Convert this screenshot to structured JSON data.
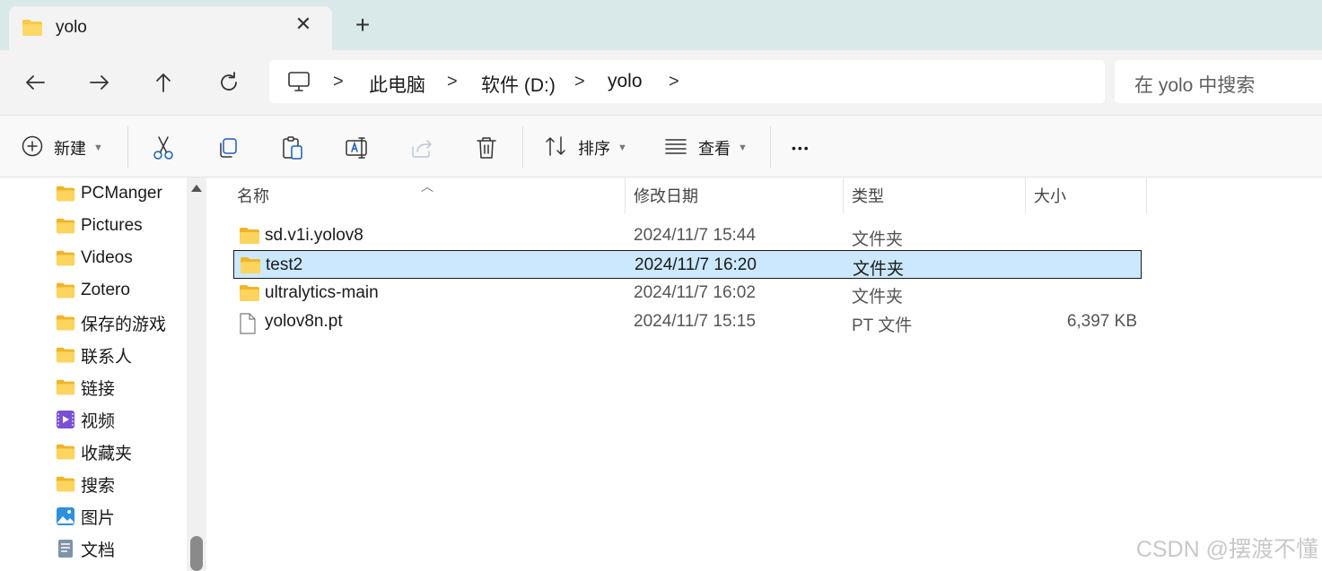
{
  "tab": {
    "title": "yolo",
    "close_glyph": "✕",
    "new_tab_glyph": "+"
  },
  "nav_buttons": [
    "back-icon",
    "forward-icon",
    "up-icon",
    "refresh-icon"
  ],
  "address": {
    "separator": ">",
    "items": [
      "此电脑",
      "软件 (D:)",
      "yolo"
    ]
  },
  "search": {
    "placeholder": "在 yolo 中搜索"
  },
  "toolbar": {
    "new_label": "新建",
    "sort_label": "排序",
    "view_label": "查看",
    "more_glyph": "•••"
  },
  "sidebar": {
    "items": [
      {
        "label": "PCManger",
        "icon": "folder-icon"
      },
      {
        "label": "Pictures",
        "icon": "folder-icon"
      },
      {
        "label": "Videos",
        "icon": "folder-icon"
      },
      {
        "label": "Zotero",
        "icon": "folder-icon"
      },
      {
        "label": "保存的游戏",
        "icon": "folder-icon"
      },
      {
        "label": "联系人",
        "icon": "folder-icon"
      },
      {
        "label": "链接",
        "icon": "folder-icon"
      },
      {
        "label": "视频",
        "icon": "video-icon"
      },
      {
        "label": "收藏夹",
        "icon": "folder-icon"
      },
      {
        "label": "搜索",
        "icon": "folder-icon"
      },
      {
        "label": "图片",
        "icon": "pictures-icon"
      },
      {
        "label": "文档",
        "icon": "document-icon"
      }
    ]
  },
  "columns": {
    "name": "名称",
    "date": "修改日期",
    "type": "类型",
    "size": "大小"
  },
  "files": [
    {
      "name": "sd.v1i.yolov8",
      "date": "2024/11/7 15:44",
      "type": "文件夹",
      "size": "",
      "icon": "folder-icon",
      "selected": false
    },
    {
      "name": "test2",
      "date": "2024/11/7 16:20",
      "type": "文件夹",
      "size": "",
      "icon": "folder-icon",
      "selected": true
    },
    {
      "name": "ultralytics-main",
      "date": "2024/11/7 16:02",
      "type": "文件夹",
      "size": "",
      "icon": "folder-icon",
      "selected": false
    },
    {
      "name": "yolov8n.pt",
      "date": "2024/11/7 15:15",
      "type": "PT 文件",
      "size": "6,397 KB",
      "icon": "file-icon",
      "selected": false
    }
  ],
  "watermark": "CSDN @摆渡不懂",
  "colors": {
    "folder": "#f8c94a",
    "selection": "#cce8ff",
    "tab_strip": "#d9e8e8"
  }
}
